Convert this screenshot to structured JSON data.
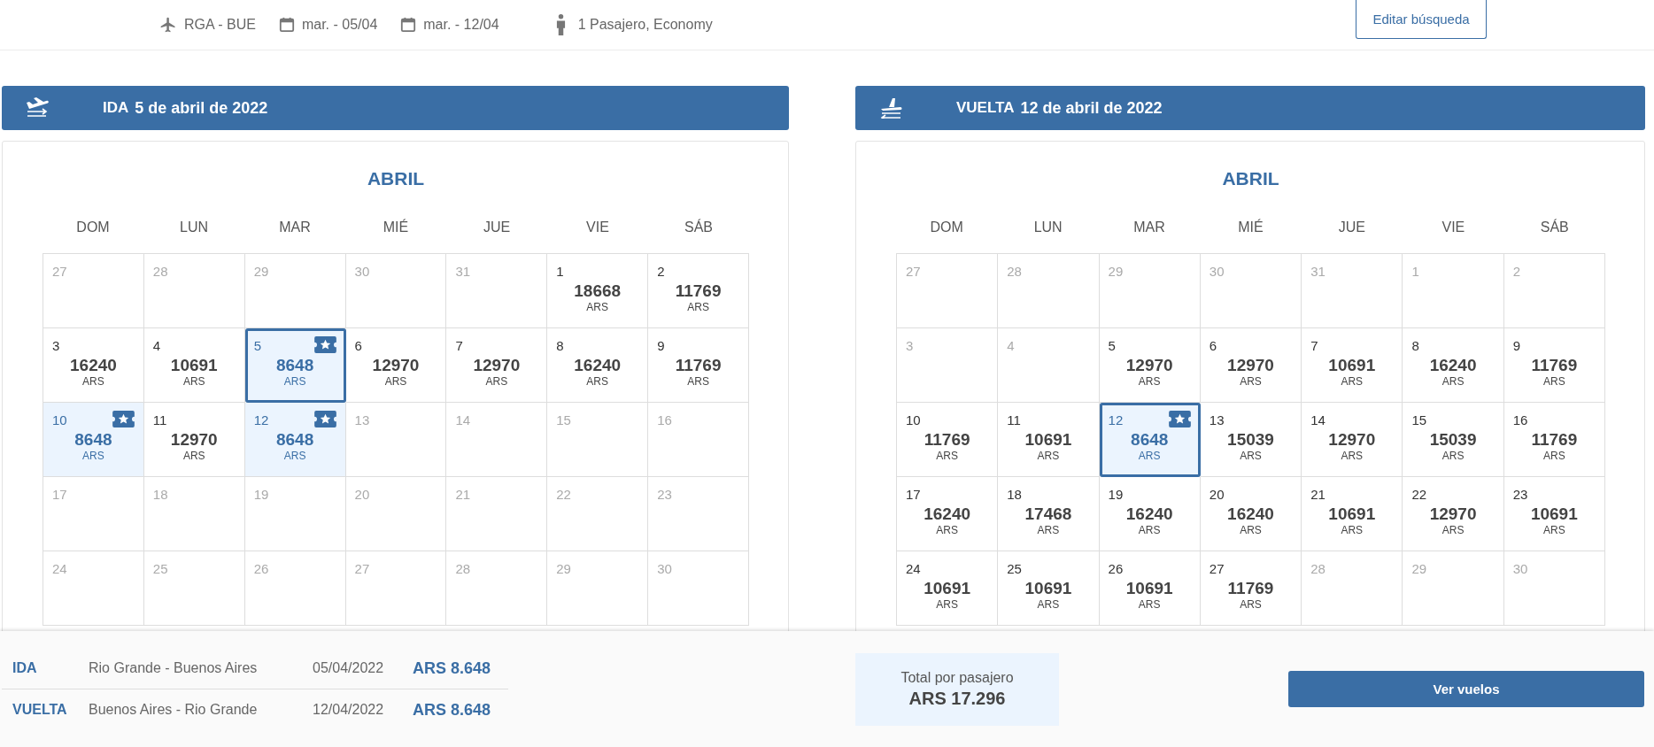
{
  "search_summary": {
    "route": "RGA - BUE",
    "departure": "mar. - 05/04",
    "return": "mar. - 12/04",
    "passengers": "1 Pasajero, Economy",
    "edit_button": "Editar búsqueda"
  },
  "legs": [
    {
      "kind": "outbound",
      "label": "IDA",
      "date": "5 de abril de 2022",
      "month": "ABRIL",
      "weekdays": [
        "DOM",
        "LUN",
        "MAR",
        "MIÉ",
        "JUE",
        "VIE",
        "SÁB"
      ],
      "weeks": [
        [
          {
            "day": "27",
            "available": false,
            "selected": false,
            "cheapest": false
          },
          {
            "day": "28",
            "available": false,
            "selected": false,
            "cheapest": false
          },
          {
            "day": "29",
            "available": false,
            "selected": false,
            "cheapest": false
          },
          {
            "day": "30",
            "available": false,
            "selected": false,
            "cheapest": false
          },
          {
            "day": "31",
            "available": false,
            "selected": false,
            "cheapest": false
          },
          {
            "day": "1",
            "available": true,
            "price": "18668",
            "currency": "ARS",
            "selected": false,
            "cheapest": false
          },
          {
            "day": "2",
            "available": true,
            "price": "11769",
            "currency": "ARS",
            "selected": false,
            "cheapest": false
          }
        ],
        [
          {
            "day": "3",
            "available": true,
            "price": "16240",
            "currency": "ARS",
            "selected": false,
            "cheapest": false
          },
          {
            "day": "4",
            "available": true,
            "price": "10691",
            "currency": "ARS",
            "selected": false,
            "cheapest": false
          },
          {
            "day": "5",
            "available": true,
            "price": "8648",
            "currency": "ARS",
            "selected": true,
            "cheapest": true
          },
          {
            "day": "6",
            "available": true,
            "price": "12970",
            "currency": "ARS",
            "selected": false,
            "cheapest": false
          },
          {
            "day": "7",
            "available": true,
            "price": "12970",
            "currency": "ARS",
            "selected": false,
            "cheapest": false
          },
          {
            "day": "8",
            "available": true,
            "price": "16240",
            "currency": "ARS",
            "selected": false,
            "cheapest": false
          },
          {
            "day": "9",
            "available": true,
            "price": "11769",
            "currency": "ARS",
            "selected": false,
            "cheapest": false
          }
        ],
        [
          {
            "day": "10",
            "available": true,
            "price": "8648",
            "currency": "ARS",
            "selected": false,
            "cheapest": true
          },
          {
            "day": "11",
            "available": true,
            "price": "12970",
            "currency": "ARS",
            "selected": false,
            "cheapest": false
          },
          {
            "day": "12",
            "available": true,
            "price": "8648",
            "currency": "ARS",
            "selected": false,
            "cheapest": true
          },
          {
            "day": "13",
            "available": false,
            "selected": false,
            "cheapest": false
          },
          {
            "day": "14",
            "available": false,
            "selected": false,
            "cheapest": false
          },
          {
            "day": "15",
            "available": false,
            "selected": false,
            "cheapest": false
          },
          {
            "day": "16",
            "available": false,
            "selected": false,
            "cheapest": false
          }
        ],
        [
          {
            "day": "17",
            "available": false,
            "selected": false,
            "cheapest": false
          },
          {
            "day": "18",
            "available": false,
            "selected": false,
            "cheapest": false
          },
          {
            "day": "19",
            "available": false,
            "selected": false,
            "cheapest": false
          },
          {
            "day": "20",
            "available": false,
            "selected": false,
            "cheapest": false
          },
          {
            "day": "21",
            "available": false,
            "selected": false,
            "cheapest": false
          },
          {
            "day": "22",
            "available": false,
            "selected": false,
            "cheapest": false
          },
          {
            "day": "23",
            "available": false,
            "selected": false,
            "cheapest": false
          }
        ],
        [
          {
            "day": "24",
            "available": false,
            "selected": false,
            "cheapest": false
          },
          {
            "day": "25",
            "available": false,
            "selected": false,
            "cheapest": false
          },
          {
            "day": "26",
            "available": false,
            "selected": false,
            "cheapest": false
          },
          {
            "day": "27",
            "available": false,
            "selected": false,
            "cheapest": false
          },
          {
            "day": "28",
            "available": false,
            "selected": false,
            "cheapest": false
          },
          {
            "day": "29",
            "available": false,
            "selected": false,
            "cheapest": false
          },
          {
            "day": "30",
            "available": false,
            "selected": false,
            "cheapest": false
          }
        ]
      ]
    },
    {
      "kind": "return",
      "label": "VUELTA",
      "date": "12 de abril de 2022",
      "month": "ABRIL",
      "weekdays": [
        "DOM",
        "LUN",
        "MAR",
        "MIÉ",
        "JUE",
        "VIE",
        "SÁB"
      ],
      "weeks": [
        [
          {
            "day": "27",
            "available": false,
            "selected": false,
            "cheapest": false
          },
          {
            "day": "28",
            "available": false,
            "selected": false,
            "cheapest": false
          },
          {
            "day": "29",
            "available": false,
            "selected": false,
            "cheapest": false
          },
          {
            "day": "30",
            "available": false,
            "selected": false,
            "cheapest": false
          },
          {
            "day": "31",
            "available": false,
            "selected": false,
            "cheapest": false
          },
          {
            "day": "1",
            "available": false,
            "selected": false,
            "cheapest": false
          },
          {
            "day": "2",
            "available": false,
            "selected": false,
            "cheapest": false
          }
        ],
        [
          {
            "day": "3",
            "available": false,
            "selected": false,
            "cheapest": false
          },
          {
            "day": "4",
            "available": false,
            "selected": false,
            "cheapest": false
          },
          {
            "day": "5",
            "available": true,
            "price": "12970",
            "currency": "ARS",
            "selected": false,
            "cheapest": false
          },
          {
            "day": "6",
            "available": true,
            "price": "12970",
            "currency": "ARS",
            "selected": false,
            "cheapest": false
          },
          {
            "day": "7",
            "available": true,
            "price": "10691",
            "currency": "ARS",
            "selected": false,
            "cheapest": false
          },
          {
            "day": "8",
            "available": true,
            "price": "16240",
            "currency": "ARS",
            "selected": false,
            "cheapest": false
          },
          {
            "day": "9",
            "available": true,
            "price": "11769",
            "currency": "ARS",
            "selected": false,
            "cheapest": false
          }
        ],
        [
          {
            "day": "10",
            "available": true,
            "price": "11769",
            "currency": "ARS",
            "selected": false,
            "cheapest": false
          },
          {
            "day": "11",
            "available": true,
            "price": "10691",
            "currency": "ARS",
            "selected": false,
            "cheapest": false
          },
          {
            "day": "12",
            "available": true,
            "price": "8648",
            "currency": "ARS",
            "selected": true,
            "cheapest": true
          },
          {
            "day": "13",
            "available": true,
            "price": "15039",
            "currency": "ARS",
            "selected": false,
            "cheapest": false
          },
          {
            "day": "14",
            "available": true,
            "price": "12970",
            "currency": "ARS",
            "selected": false,
            "cheapest": false
          },
          {
            "day": "15",
            "available": true,
            "price": "15039",
            "currency": "ARS",
            "selected": false,
            "cheapest": false
          },
          {
            "day": "16",
            "available": true,
            "price": "11769",
            "currency": "ARS",
            "selected": false,
            "cheapest": false
          }
        ],
        [
          {
            "day": "17",
            "available": true,
            "price": "16240",
            "currency": "ARS",
            "selected": false,
            "cheapest": false
          },
          {
            "day": "18",
            "available": true,
            "price": "17468",
            "currency": "ARS",
            "selected": false,
            "cheapest": false
          },
          {
            "day": "19",
            "available": true,
            "price": "16240",
            "currency": "ARS",
            "selected": false,
            "cheapest": false
          },
          {
            "day": "20",
            "available": true,
            "price": "16240",
            "currency": "ARS",
            "selected": false,
            "cheapest": false
          },
          {
            "day": "21",
            "available": true,
            "price": "10691",
            "currency": "ARS",
            "selected": false,
            "cheapest": false
          },
          {
            "day": "22",
            "available": true,
            "price": "12970",
            "currency": "ARS",
            "selected": false,
            "cheapest": false
          },
          {
            "day": "23",
            "available": true,
            "price": "10691",
            "currency": "ARS",
            "selected": false,
            "cheapest": false
          }
        ],
        [
          {
            "day": "24",
            "available": true,
            "price": "10691",
            "currency": "ARS",
            "selected": false,
            "cheapest": false
          },
          {
            "day": "25",
            "available": true,
            "price": "10691",
            "currency": "ARS",
            "selected": false,
            "cheapest": false
          },
          {
            "day": "26",
            "available": true,
            "price": "10691",
            "currency": "ARS",
            "selected": false,
            "cheapest": false
          },
          {
            "day": "27",
            "available": true,
            "price": "11769",
            "currency": "ARS",
            "selected": false,
            "cheapest": false
          },
          {
            "day": "28",
            "available": false,
            "selected": false,
            "cheapest": false
          },
          {
            "day": "29",
            "available": false,
            "selected": false,
            "cheapest": false
          },
          {
            "day": "30",
            "available": false,
            "selected": false,
            "cheapest": false
          }
        ]
      ]
    }
  ],
  "summary": {
    "rows": [
      {
        "label": "IDA",
        "route": "Rio Grande - Buenos Aires",
        "date": "05/04/2022",
        "price": "ARS 8.648"
      },
      {
        "label": "VUELTA",
        "route": "Buenos Aires - Rio Grande",
        "date": "12/04/2022",
        "price": "ARS 8.648"
      }
    ],
    "total_label": "Total por pasajero",
    "total": "ARS 17.296",
    "button": "Ver vuelos"
  }
}
